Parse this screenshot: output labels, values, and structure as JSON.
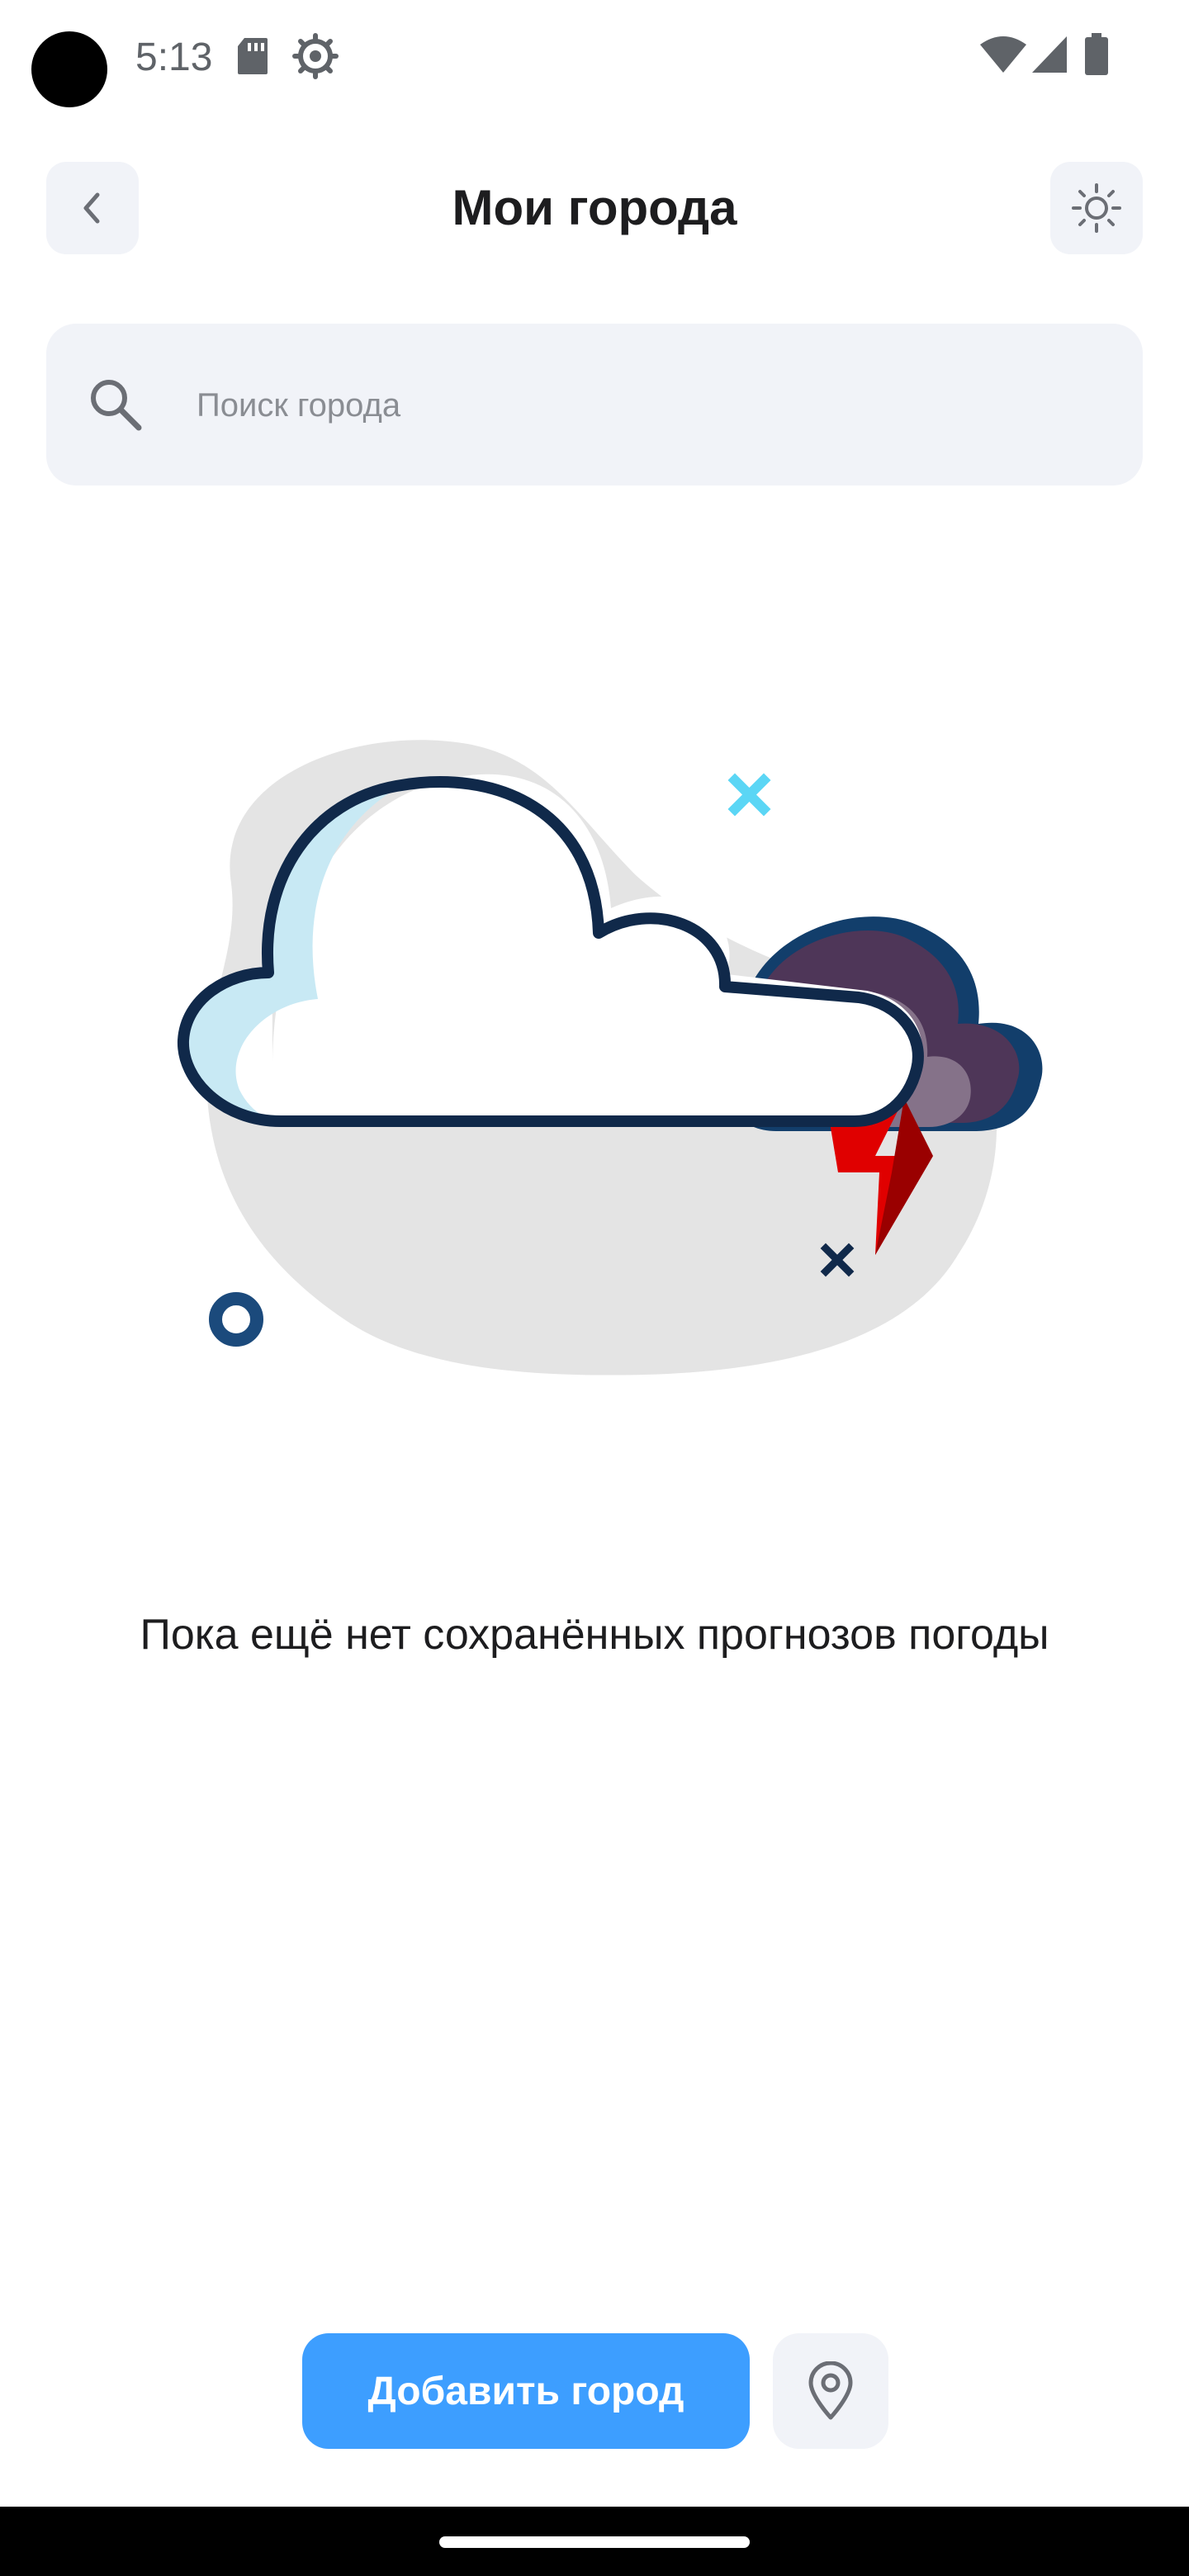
{
  "status_bar": {
    "time": "5:13"
  },
  "header": {
    "title": "Мои города",
    "back_icon": "chevron-left-icon",
    "theme_icon": "sun-icon"
  },
  "search": {
    "placeholder": "Поиск города",
    "value": "",
    "icon": "search-icon"
  },
  "empty_state": {
    "message": "Пока ещё нет сохранённых прогнозов погоды",
    "illustration": "storm-cloud-illustration"
  },
  "actions": {
    "add_city_label": "Добавить город",
    "location_icon": "location-pin-icon"
  },
  "colors": {
    "accent": "#3d9eff",
    "button_bg": "#f1f3f8",
    "text": "#1d1d1f",
    "placeholder": "#8a8d93"
  }
}
